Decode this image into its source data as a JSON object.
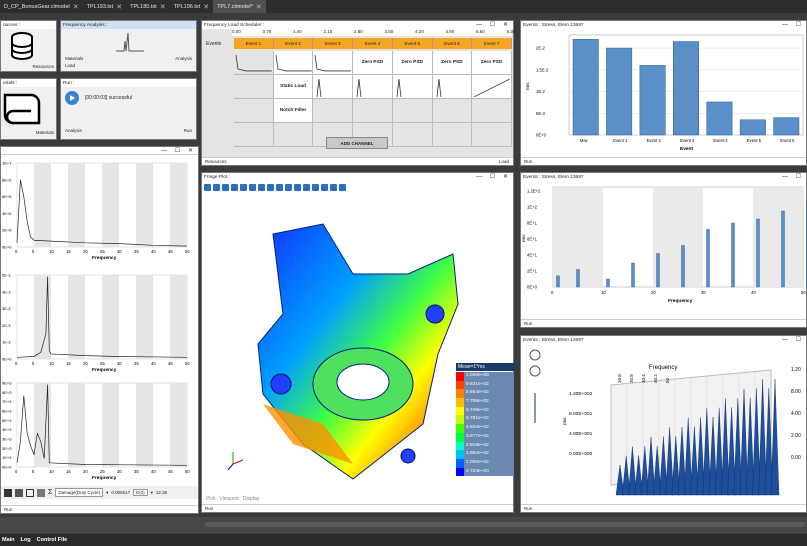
{
  "tabs": [
    {
      "label": "D_CP_BonusGear.clmodel",
      "active": false
    },
    {
      "label": "TPL193.txt",
      "active": false
    },
    {
      "label": "TPL180.txt",
      "active": false
    },
    {
      "label": "TPL196.txt",
      "active": false
    },
    {
      "label": "TPL7.clmodel*",
      "active": true
    }
  ],
  "left_top": {
    "panel1": {
      "title": "ources :",
      "port": "Resources"
    },
    "panel2": {
      "title": "Frequency Analysis :",
      "ports_in": [
        "Materials",
        "Load"
      ],
      "port_out": "Analysis"
    },
    "panel3": {
      "title": "erials :",
      "port": "Materials"
    },
    "panel4": {
      "title": "Run :",
      "message": "[00:00:03] successful",
      "port_in": "Analysis",
      "port_out": "Run"
    }
  },
  "left_plots": {
    "top": {
      "xlabel": "Frequency",
      "yticks": [
        "1E+7",
        "8E+6",
        "6E+6",
        "4E+6",
        "2E+6",
        "0E+0"
      ],
      "xticks": [
        "0",
        "5",
        "10",
        "15",
        "20",
        "25",
        "30",
        "35",
        "40",
        "45",
        "50"
      ]
    },
    "mid": {
      "xlabel": "Frequency",
      "yticks": [
        "5E-3",
        "4E-3",
        "3E-3",
        "2E-3",
        "1E-3",
        "0E+0"
      ]
    },
    "bot": {
      "xlabel": "Frequency",
      "yticks": [
        "9E+3",
        "8E+3",
        "7E+3",
        "6E+3",
        "5E+3",
        "4E+3",
        "3E+3",
        "2E+3",
        "1E+3",
        "0E+0"
      ]
    },
    "footer": {
      "dropdown": "Damage(Duty Cycle)",
      "value1": "0.006517",
      "value2": "E(0)",
      "value3": "12.36",
      "port": "Run"
    }
  },
  "scheduler": {
    "title": "Frequency Load Scheduler :",
    "ticks": [
      "0.00",
      "0.70",
      "1.40",
      "2.10",
      "2.80",
      "3.50",
      "4.20",
      "4.90",
      "5.60",
      "6.30"
    ],
    "events_label": "Events",
    "events": [
      "Event 1",
      "Event 2",
      "Event 3",
      "Event 4",
      "Event 5",
      "Event 6",
      "Event 7"
    ],
    "zero_psd": "Zero PSD",
    "static_load": "Static Load",
    "notch_filter": "Notch Filter",
    "add_channel": "ADD CHANNEL",
    "port_in": "Resources",
    "port_out": "Load"
  },
  "fringe": {
    "title": "Fringe Plot :",
    "legend_title": "Mean=1*ms",
    "legend": [
      {
        "v": "1.058e+03",
        "c": "#ff0000"
      },
      {
        "v": "9.621e+02",
        "c": "#ff4000"
      },
      {
        "v": "8.664e+02",
        "c": "#ff8000"
      },
      {
        "v": "7.706e+02",
        "c": "#ffbf00"
      },
      {
        "v": "6.749e+02",
        "c": "#ffff00"
      },
      {
        "v": "5.791e+02",
        "c": "#bfff00"
      },
      {
        "v": "4.834e+02",
        "c": "#40ff00"
      },
      {
        "v": "3.877e+02",
        "c": "#00ff40"
      },
      {
        "v": "2.919e+02",
        "c": "#00ffbf"
      },
      {
        "v": "1.962e+02",
        "c": "#00bfff"
      },
      {
        "v": "1.005e+02",
        "c": "#0060ff"
      },
      {
        "v": "4.724e+00",
        "c": "#0000ff"
      }
    ],
    "controls": [
      "Pick",
      "Viewport",
      "Display"
    ],
    "port": "Run"
  },
  "events_bar": {
    "title": "Events : Stress, Elem 13697",
    "ylabel": "rms",
    "xlabel": "Event",
    "port": "Run"
  },
  "events_lines": {
    "title": "Events : Stress, Elem 13697",
    "ylabel": "rms",
    "xlabel": "Frequency",
    "port": "Run"
  },
  "events_3d": {
    "title": "Events : Stress, Elem 13697",
    "axis_label": "Frequency",
    "ylabel": "rms",
    "zticks": [
      "1.20E+002",
      "8.00E+001",
      "4.00E+001",
      "0.00E+000"
    ],
    "ticks_right": [
      "1.20",
      "8.00",
      "4.00",
      "2.00",
      "0.00"
    ],
    "xticks": [
      "10.8",
      "20.8",
      "30.4",
      "40.2",
      "50"
    ],
    "port": "Run"
  },
  "chart_data": [
    {
      "type": "bar",
      "title": "Events : Stress, Elem 13697",
      "categories": [
        "Max",
        "Event 1",
        "Event 2",
        "Event 3",
        "Event 4",
        "Event 5",
        "Event 6"
      ],
      "values": [
        0.022,
        0.02,
        0.016,
        0.0215,
        0.0076,
        0.0035,
        0.004
      ],
      "xlabel": "Event",
      "ylabel": "rms",
      "yticks": [
        "0E+0",
        "5E-3",
        "1E-2",
        "1.5E-2",
        "2E-2"
      ],
      "ylim": [
        0,
        0.023
      ]
    },
    {
      "type": "bar",
      "title": "Events : Stress, Elem 13697",
      "x": [
        1,
        5,
        11,
        16,
        21,
        26,
        31,
        36,
        41,
        46,
        51
      ],
      "values": [
        14,
        22,
        10,
        30,
        42,
        52,
        72,
        80,
        85,
        95,
        107
      ],
      "xlabel": "Frequency",
      "ylabel": "rms",
      "yticks": [
        "0E+0",
        "2E+1",
        "4E+1",
        "6E+1",
        "8E+1",
        "1E+2",
        "1.2E+2"
      ],
      "xticks": [
        "0",
        "10",
        "20",
        "30",
        "40",
        "50"
      ],
      "ylim": [
        0,
        125
      ],
      "xlim": [
        0,
        50
      ]
    }
  ],
  "status": [
    "Main",
    "Log",
    "Control File"
  ]
}
